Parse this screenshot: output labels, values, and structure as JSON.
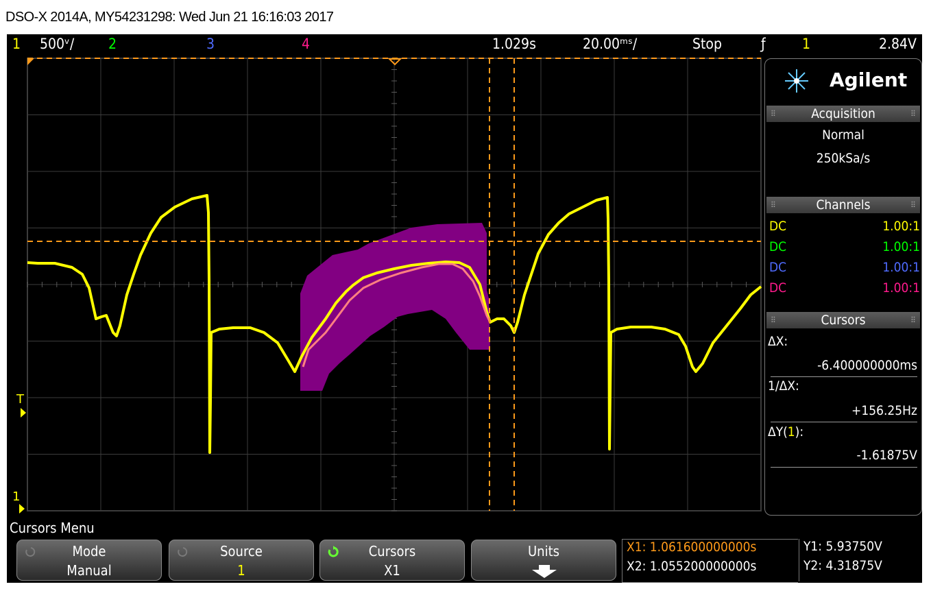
{
  "title": "DSO-X 2014A, MY54231298: Wed Jun 21 16:16:03 2017",
  "status": {
    "ch1_num": "1",
    "ch1_scale": "500ᵛ/",
    "ch2_num": "2",
    "ch3_num": "3",
    "ch4_num": "4",
    "time_pos": "1.029s",
    "time_scale": "20.00ᵐˢ/",
    "run_state": "Stop",
    "trig_symbol": "ƒ",
    "trig_source": "1",
    "trig_level": "2.84V"
  },
  "colors": {
    "ch1": "#ffff00",
    "ch2": "#00ff00",
    "ch3": "#4f6bff",
    "ch4": "#ff1a8c",
    "cursor": "#ff9a1a",
    "math": "#ff8080",
    "overlay": "#820082"
  },
  "screen_markers": {
    "trigger_marker": "T",
    "ch1_ground_marker": "1"
  },
  "panel": {
    "brand": "Agilent",
    "acquisition_header": "Acquisition",
    "acq_mode": "Normal",
    "acq_rate": "250kSa/s",
    "channels_header": "Channels",
    "channels": [
      {
        "coupling": "DC",
        "probe": "1.00:1"
      },
      {
        "coupling": "DC",
        "probe": "1.00:1"
      },
      {
        "coupling": "DC",
        "probe": "1.00:1"
      },
      {
        "coupling": "DC",
        "probe": "1.00:1"
      }
    ],
    "cursors_header": "Cursors",
    "dx_label": "ΔX:",
    "dx_value": "-6.400000000ms",
    "inv_dx_label": "1/ΔX:",
    "inv_dx_value": "+156.25Hz",
    "dy_label_pre": "ΔY(",
    "dy_label_src": "1",
    "dy_label_post": "):",
    "dy_value": "-1.61875V"
  },
  "menu": {
    "title": "Cursors Menu",
    "softkeys": [
      {
        "label": "Mode",
        "value": "Manual"
      },
      {
        "label": "Source",
        "value": "1"
      },
      {
        "label": "Cursors",
        "value": "X1"
      },
      {
        "label": "Units",
        "value": ""
      }
    ],
    "readout": {
      "x1": "X1: 1.061600000000s",
      "x2": "X2: 1.055200000000s",
      "y1": "Y1: 5.93750V",
      "y2": "Y2: 4.31875V"
    }
  }
}
